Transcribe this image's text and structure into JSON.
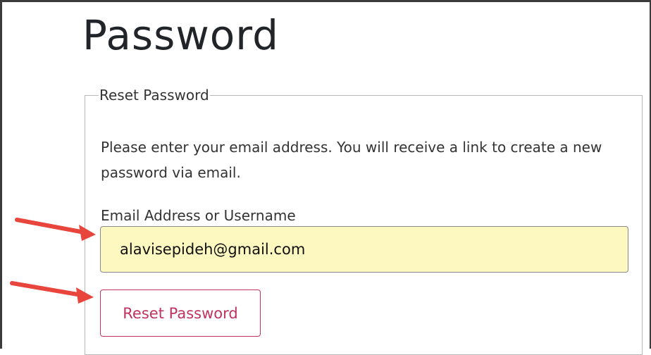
{
  "page": {
    "title": "Password"
  },
  "reset_form": {
    "legend": "Reset Password",
    "instructions": "Please enter your email address. You will receive a link to create a new password via email.",
    "email_label": "Email Address or Username",
    "email_value": "alavisepideh@gmail.com",
    "submit_label": "Reset Password"
  },
  "annotations": {
    "arrow_color": "#e8453c",
    "items": [
      {
        "name": "arrow-icon",
        "points_to": "email-input"
      },
      {
        "name": "arrow-icon",
        "points_to": "reset-password-button"
      }
    ]
  },
  "colors": {
    "input_background": "#fdf8bf",
    "button_accent": "#c0325f"
  }
}
